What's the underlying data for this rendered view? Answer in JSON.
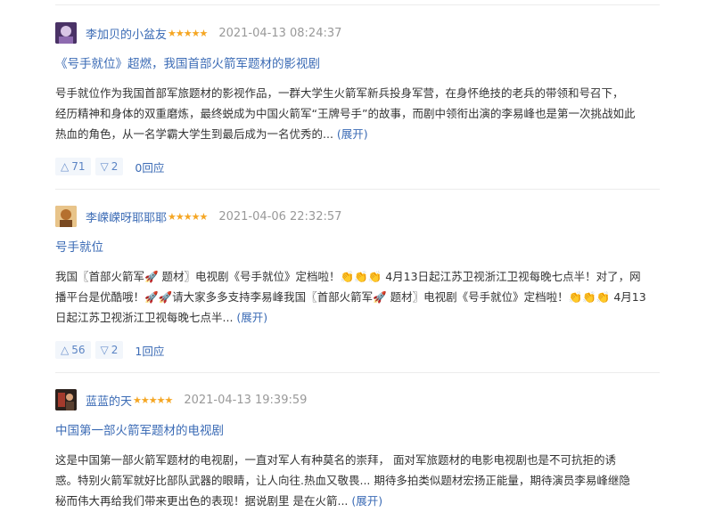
{
  "reviews": [
    {
      "username": "李加贝的小盆友",
      "stars": "★★★★★",
      "time": "2021-04-13 08:24:37",
      "title": "《号手就位》超燃，我国首部火箭军题材的影视剧",
      "body_lines": [
        "号手就位作为我国首部军旅题材的影视作品，一群大学生火箭军新兵投身军营，在身怀绝技的老兵的带领和号召下，",
        "经历精神和身体的双重磨炼，最终蜕成为中国火箭军“王牌号手”的故事，而剧中领衔出演的李易峰也是第一次挑战如此",
        "热血的角色，从一名学霸大学生到最后成为一名优秀的..."
      ],
      "expand_label": "(展开)",
      "upvotes": "71",
      "downvotes": "2",
      "reply_label": "0回应",
      "avatar_color": "#5b3f78"
    },
    {
      "username": "李嵘嵘呀耶耶耶",
      "stars": "★★★★★",
      "time": "2021-04-06 22:32:57",
      "title": "号手就位",
      "body_lines": [
        "我国〖首部火箭军🚀 题材〗电视剧《号手就位》定档啦！👏👏👏 4月13日起江苏卫视浙江卫视每晚七点半！对了，网",
        "播平台是优酷哦！🚀🚀请大家多多支持李易峰我国〖首部火箭军🚀 题材〗电视剧《号手就位》定档啦！👏👏👏 4月13",
        "日起江苏卫视浙江卫视每晚七点半..."
      ],
      "expand_label": "(展开)",
      "upvotes": "56",
      "downvotes": "2",
      "reply_label": "1回应",
      "avatar_color": "#c98a3c"
    },
    {
      "username": "蓝蓝的天",
      "stars": "★★★★★",
      "time": "2021-04-13 19:39:59",
      "title": "中国第一部火箭军题材的电视剧",
      "body_lines": [
        "这是中国第一部火箭军题材的电视剧，一直对军人有种莫名的崇拜， 面对军旅题材的电影电视剧也是不可抗拒的诱",
        "惑。特别火箭军就好比部队武器的眼睛，让人向往.热血又敬畏... 期待多拍类似题材宏扬正能量，期待演员李易峰继隐",
        "秘而伟大再给我们带来更出色的表现！据说剧里 是在火箭..."
      ],
      "expand_label": "(展开)",
      "avatar_color": "#3a2a22"
    }
  ],
  "icons": {
    "upvote": "up-triangle",
    "downvote": "down-triangle"
  },
  "colors": {
    "link": "#3b6bb5",
    "star": "#f5a623",
    "vote_bg": "#f2f6fb",
    "muted": "#999999"
  }
}
